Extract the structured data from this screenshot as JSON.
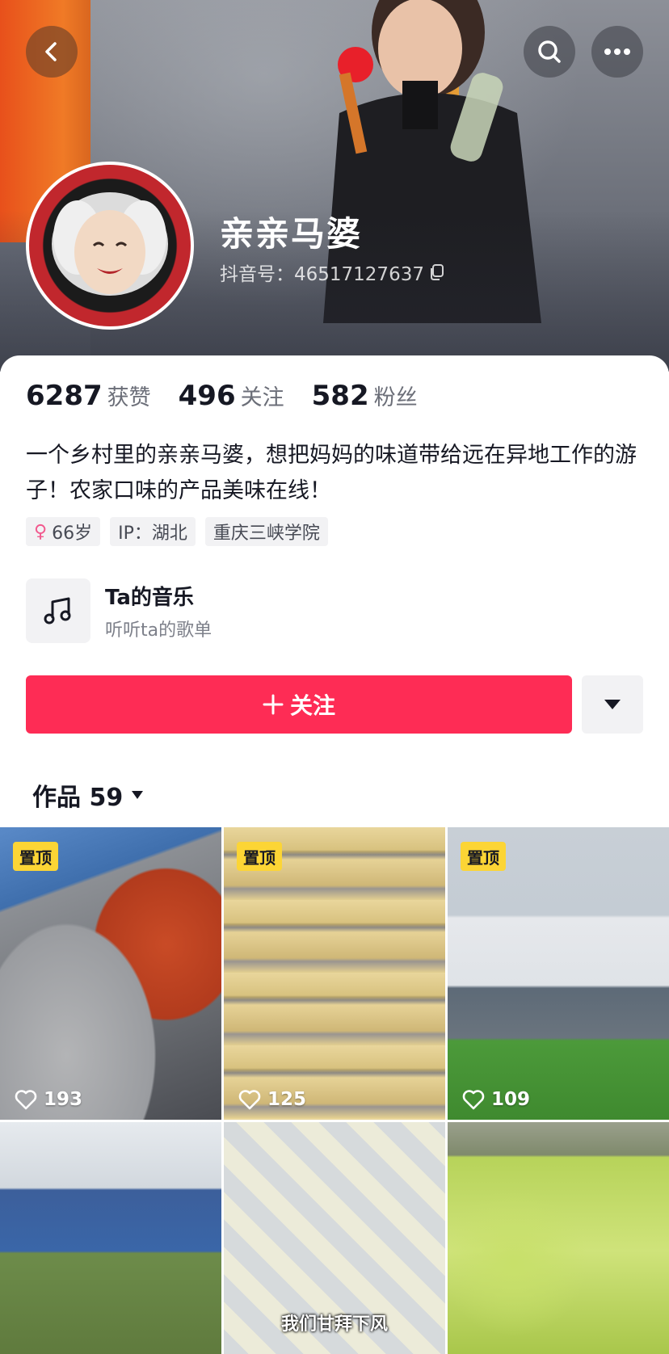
{
  "profile": {
    "name": "亲亲马婆",
    "douyin_id": "抖音号：46517127637"
  },
  "stats": [
    {
      "value": "6287",
      "label": "获赞"
    },
    {
      "value": "496",
      "label": "关注"
    },
    {
      "value": "582",
      "label": "粉丝"
    }
  ],
  "bio": "一个乡村里的亲亲马婆，想把妈妈的味道带给远在异地工作的游子！农家口味的产品美味在线！",
  "tags": {
    "age": "66岁",
    "ip": "IP：湖北",
    "school": "重庆三峡学院"
  },
  "music": {
    "title": "Ta的音乐",
    "subtitle": "听听ta的歌单"
  },
  "actions": {
    "follow_label": "关注"
  },
  "works": {
    "label": "作品 59"
  },
  "grid": {
    "pin_label": "置顶",
    "items": [
      {
        "likes": "193"
      },
      {
        "likes": "125"
      },
      {
        "likes": "109"
      },
      {
        "caption": ""
      },
      {
        "caption": "我们甘拜下风"
      },
      {
        "caption": ""
      }
    ]
  },
  "colors": {
    "accent": "#fe2c55",
    "pin": "#fcd535"
  },
  "icons": [
    "back-icon",
    "search-icon",
    "more-icon",
    "copy-icon",
    "female-icon",
    "music-note-icon",
    "plus-icon",
    "caret-down-icon",
    "heart-icon"
  ]
}
